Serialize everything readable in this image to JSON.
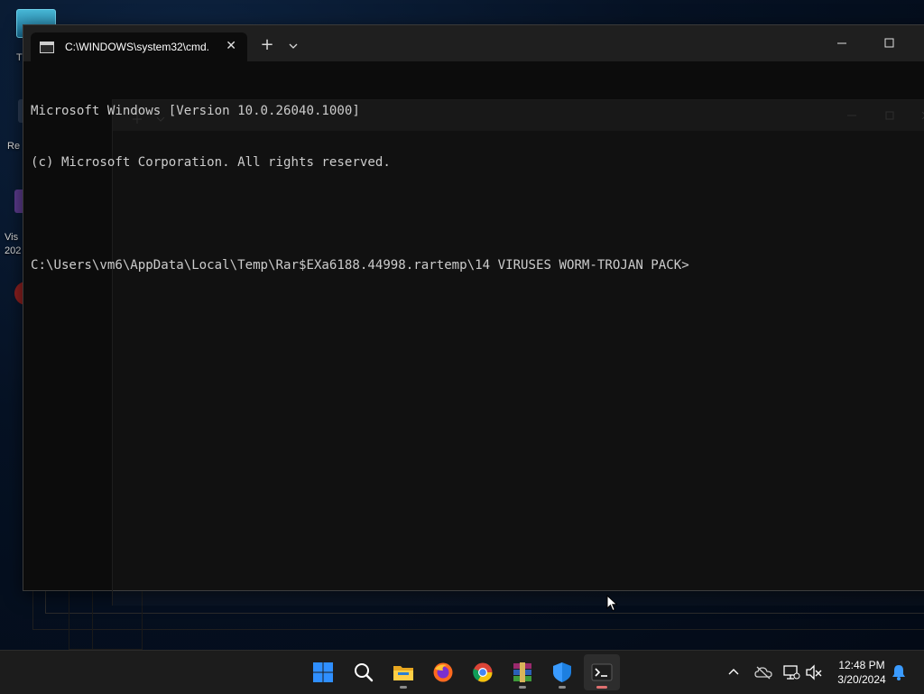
{
  "desktop": {
    "icons": [
      {
        "label": "T"
      },
      {
        "label": "Re"
      },
      {
        "label": "Vis\n202"
      },
      {
        "label": ""
      }
    ]
  },
  "terminal": {
    "tab_title": "C:\\WINDOWS\\system32\\cmd.",
    "close_glyph": "✕",
    "new_tab_glyph": "+",
    "lines": [
      "Microsoft Windows [Version 10.0.26040.1000]",
      "(c) Microsoft Corporation. All rights reserved.",
      "",
      "C:\\Users\\vm6\\AppData\\Local\\Temp\\Rar$EXa6188.44998.rartemp\\14 VIRUSES WORM-TROJAN PACK>"
    ]
  },
  "taskbar": {
    "apps": [
      "start-icon",
      "search-icon",
      "file-explorer-icon",
      "firefox-icon",
      "chrome-icon",
      "winrar-icon",
      "windows-security-icon",
      "terminal-icon"
    ],
    "tray_icons": [
      "chevron-up-icon",
      "onedrive-icon",
      "network-icon",
      "volume-muted-icon",
      "notification-bell-icon"
    ],
    "clock": {
      "time": "12:48 PM",
      "date": "3/20/2024"
    }
  },
  "colors": {
    "terminal_bg": "#0c0c0c",
    "titlebar_bg": "#1f1f1f",
    "console_text": "#cccccc",
    "taskbar_bg": "#1c1c1c",
    "accent_blue": "#2f8fff"
  }
}
